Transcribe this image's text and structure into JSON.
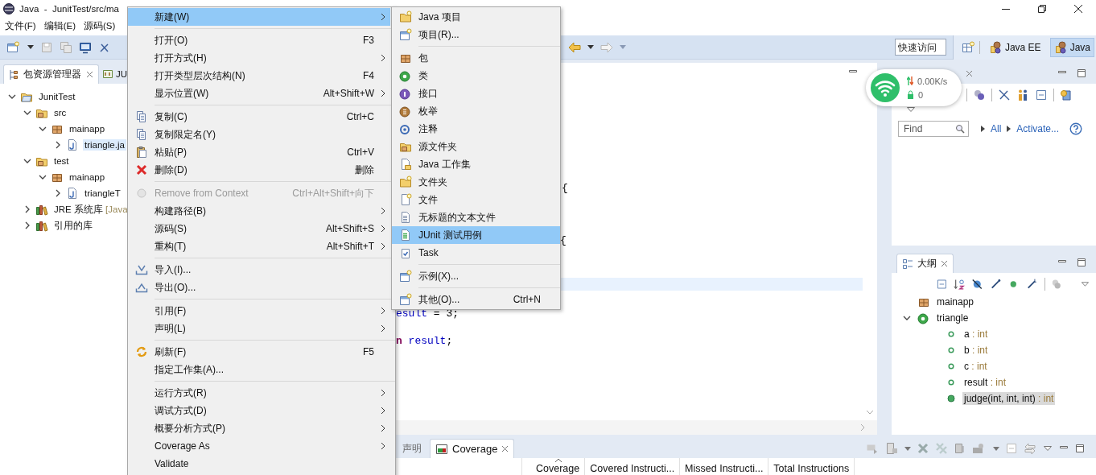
{
  "window": {
    "title": "Java  -  JunitTest/src/ma"
  },
  "menubar": [
    {
      "label": "文件(F)"
    },
    {
      "label": "编辑(E)"
    },
    {
      "label": "源码(S)"
    }
  ],
  "quick_access": {
    "placeholder": "快速访问"
  },
  "perspectives": [
    {
      "label": "Java EE",
      "selected": false
    },
    {
      "label": "Java",
      "selected": true
    }
  ],
  "package_explorer": {
    "tabs": [
      {
        "label": "包资源管理器",
        "selected": true
      },
      {
        "label": "JU",
        "selected": false
      }
    ],
    "tree": [
      {
        "label": "JunitTest",
        "kind": "project",
        "expanded": true,
        "selected": false,
        "children": [
          {
            "label": "src",
            "kind": "source-folder",
            "expanded": true,
            "selected": false,
            "children": [
              {
                "label": "mainapp",
                "kind": "package",
                "expanded": true,
                "selected": false,
                "children": [
                  {
                    "label": "triangle.ja",
                    "kind": "java-file",
                    "expanded": false,
                    "selected": true
                  }
                ]
              }
            ]
          },
          {
            "label": "test",
            "kind": "source-folder",
            "expanded": true,
            "selected": false,
            "children": [
              {
                "label": "mainapp",
                "kind": "package",
                "expanded": true,
                "selected": false,
                "children": [
                  {
                    "label": "triangleT",
                    "kind": "java-file",
                    "expanded": false,
                    "selected": false
                  }
                ]
              }
            ]
          },
          {
            "label": "JRE 系统库",
            "decoration": "[Java",
            "kind": "library",
            "expanded": false,
            "selected": false
          },
          {
            "label": "引用的库",
            "kind": "library",
            "expanded": false,
            "selected": false
          }
        ]
      }
    ]
  },
  "editor": {
    "lines": [
      {
        "segments": [
          {
            "text": "{",
            "kind": "plain"
          }
        ]
      },
      {
        "segments": [
          {
            "text": "{",
            "kind": "plain"
          }
        ]
      },
      {
        "segments": [
          {
            "text": "esult",
            "kind": "field"
          },
          {
            "text": " = 3;",
            "kind": "plain"
          }
        ]
      },
      {
        "segments": [
          {
            "text": "n",
            "kind": "keyword"
          },
          {
            "text": " result",
            "kind": "field"
          },
          {
            "text": ";",
            "kind": "plain"
          }
        ]
      }
    ]
  },
  "network_widget": {
    "speed": "0.00K/s",
    "count": "0"
  },
  "task_list": {
    "find": {
      "placeholder": "Find"
    },
    "links": [
      {
        "label": "All"
      },
      {
        "label": "Activate..."
      }
    ]
  },
  "outline": {
    "tab": {
      "label": "大纲",
      "selected": true
    },
    "tree": [
      {
        "label": "mainapp",
        "kind": "package",
        "selected": false
      },
      {
        "label": "triangle",
        "kind": "class",
        "expanded": true,
        "selected": false,
        "children": [
          {
            "label": "a",
            "type": ": int",
            "kind": "field",
            "selected": false
          },
          {
            "label": "b",
            "type": ": int",
            "kind": "field",
            "selected": false
          },
          {
            "label": "c",
            "type": ": int",
            "kind": "field",
            "selected": false
          },
          {
            "label": "result",
            "type": ": int",
            "kind": "field",
            "selected": false
          },
          {
            "label": "judge(int, int, int)",
            "type": ": int",
            "kind": "method",
            "selected": true
          }
        ]
      }
    ]
  },
  "bottom_panel": {
    "tabs": [
      {
        "label": "声明",
        "selected": false
      },
      {
        "label": "Coverage",
        "selected": true
      }
    ],
    "columns": [
      {
        "label": "Coverage",
        "sorted": true
      },
      {
        "label": "Covered Instructi...",
        "sorted": false
      },
      {
        "label": "Missed Instructi...",
        "sorted": false
      },
      {
        "label": "Total Instructions",
        "sorted": false
      }
    ]
  },
  "context_menu": {
    "groups": [
      [
        {
          "label": "新建(W)",
          "submenu": true,
          "selected": true,
          "disabled": false
        }
      ],
      [
        {
          "label": "打开(O)",
          "shortcut": "F3",
          "submenu": false,
          "selected": false,
          "disabled": false
        },
        {
          "label": "打开方式(H)",
          "submenu": true,
          "selected": false,
          "disabled": false
        },
        {
          "label": "打开类型层次结构(N)",
          "shortcut": "F4",
          "submenu": false,
          "selected": false,
          "disabled": false
        },
        {
          "label": "显示位置(W)",
          "shortcut": "Alt+Shift+W",
          "submenu": true,
          "selected": false,
          "disabled": false
        }
      ],
      [
        {
          "label": "复制(C)",
          "shortcut": "Ctrl+C",
          "kind": "copy",
          "submenu": false,
          "selected": false,
          "disabled": false
        },
        {
          "label": "复制限定名(Y)",
          "kind": "copy",
          "submenu": false,
          "selected": false,
          "disabled": false
        },
        {
          "label": "粘贴(P)",
          "shortcut": "Ctrl+V",
          "kind": "paste",
          "submenu": false,
          "selected": false,
          "disabled": false
        },
        {
          "label": "删除(D)",
          "shortcut": "删除",
          "kind": "delete",
          "submenu": false,
          "selected": false,
          "disabled": false
        }
      ],
      [
        {
          "label": "Remove from Context",
          "shortcut": "Ctrl+Alt+Shift+向下",
          "kind": "context",
          "submenu": false,
          "selected": false,
          "disabled": true
        },
        {
          "label": "构建路径(B)",
          "submenu": true,
          "selected": false,
          "disabled": false
        },
        {
          "label": "源码(S)",
          "shortcut": "Alt+Shift+S",
          "submenu": true,
          "selected": false,
          "disabled": false
        },
        {
          "label": "重构(T)",
          "shortcut": "Alt+Shift+T",
          "submenu": true,
          "selected": false,
          "disabled": false
        }
      ],
      [
        {
          "label": "导入(I)...",
          "kind": "import",
          "submenu": false,
          "selected": false,
          "disabled": false
        },
        {
          "label": "导出(O)...",
          "kind": "export",
          "submenu": false,
          "selected": false,
          "disabled": false
        }
      ],
      [
        {
          "label": "引用(F)",
          "submenu": true,
          "selected": false,
          "disabled": false
        },
        {
          "label": "声明(L)",
          "submenu": true,
          "selected": false,
          "disabled": false
        }
      ],
      [
        {
          "label": "刷新(F)",
          "shortcut": "F5",
          "kind": "refresh",
          "submenu": false,
          "selected": false,
          "disabled": false
        },
        {
          "label": "指定工作集(A)...",
          "submenu": false,
          "selected": false,
          "disabled": false
        }
      ],
      [
        {
          "label": "运行方式(R)",
          "submenu": true,
          "selected": false,
          "disabled": false
        },
        {
          "label": "调试方式(D)",
          "submenu": true,
          "selected": false,
          "disabled": false
        },
        {
          "label": "概要分析方式(P)",
          "submenu": true,
          "selected": false,
          "disabled": false
        },
        {
          "label": "Coverage As",
          "submenu": true,
          "selected": false,
          "disabled": false
        },
        {
          "label": "Validate",
          "submenu": false,
          "selected": false,
          "disabled": false
        }
      ]
    ]
  },
  "submenu": {
    "groups": [
      [
        {
          "label": "Java 项目",
          "kind": "java-project",
          "selected": false
        },
        {
          "label": "项目(R)...",
          "kind": "project",
          "selected": false
        }
      ],
      [
        {
          "label": "包",
          "kind": "package",
          "selected": false
        },
        {
          "label": "类",
          "kind": "class",
          "selected": false
        },
        {
          "label": "接口",
          "kind": "interface",
          "selected": false
        },
        {
          "label": "枚举",
          "kind": "enum",
          "selected": false
        },
        {
          "label": "注释",
          "kind": "annotation",
          "selected": false
        },
        {
          "label": "源文件夹",
          "kind": "source-folder",
          "selected": false
        },
        {
          "label": "Java 工作集",
          "kind": "working-set",
          "selected": false
        },
        {
          "label": "文件夹",
          "kind": "folder",
          "selected": false
        },
        {
          "label": "文件",
          "kind": "file",
          "selected": false
        },
        {
          "label": "无标题的文本文件",
          "kind": "text-file",
          "selected": false
        },
        {
          "label": "JUnit 测试用例",
          "kind": "junit",
          "selected": true
        },
        {
          "label": "Task",
          "kind": "task",
          "selected": false
        }
      ],
      [
        {
          "label": "示例(X)...",
          "kind": "project",
          "selected": false
        }
      ],
      [
        {
          "label": "其他(O)...",
          "shortcut": "Ctrl+N",
          "kind": "project",
          "selected": false
        }
      ]
    ]
  }
}
